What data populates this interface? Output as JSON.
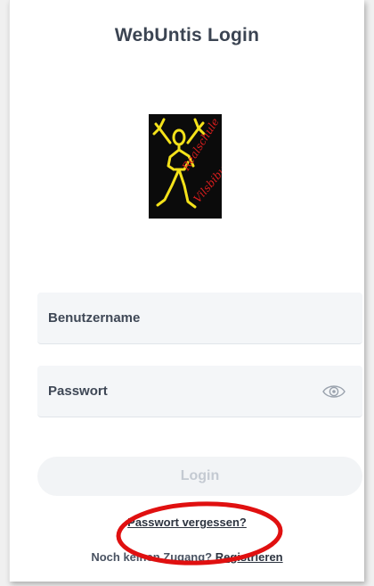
{
  "header": {
    "title": "WebUntis Login"
  },
  "logo": {
    "text_line1": "Realschule",
    "text_line2": "Vilsbiburg"
  },
  "form": {
    "username_placeholder": "Benutzername",
    "password_placeholder": "Passwort",
    "login_label": "Login"
  },
  "links": {
    "forgot_password": "Passwort vergessen?",
    "no_access_prefix": "Noch keinen Zugang?",
    "register": "Registrieren"
  },
  "colors": {
    "title": "#3b4452",
    "field_bg": "#f4f6f8",
    "button_disabled_bg": "#f2f4f6",
    "button_disabled_text": "#c4cad2",
    "logo_yellow": "#f4e21a",
    "logo_red": "#d81d1d",
    "annotation_red": "#e01010"
  }
}
